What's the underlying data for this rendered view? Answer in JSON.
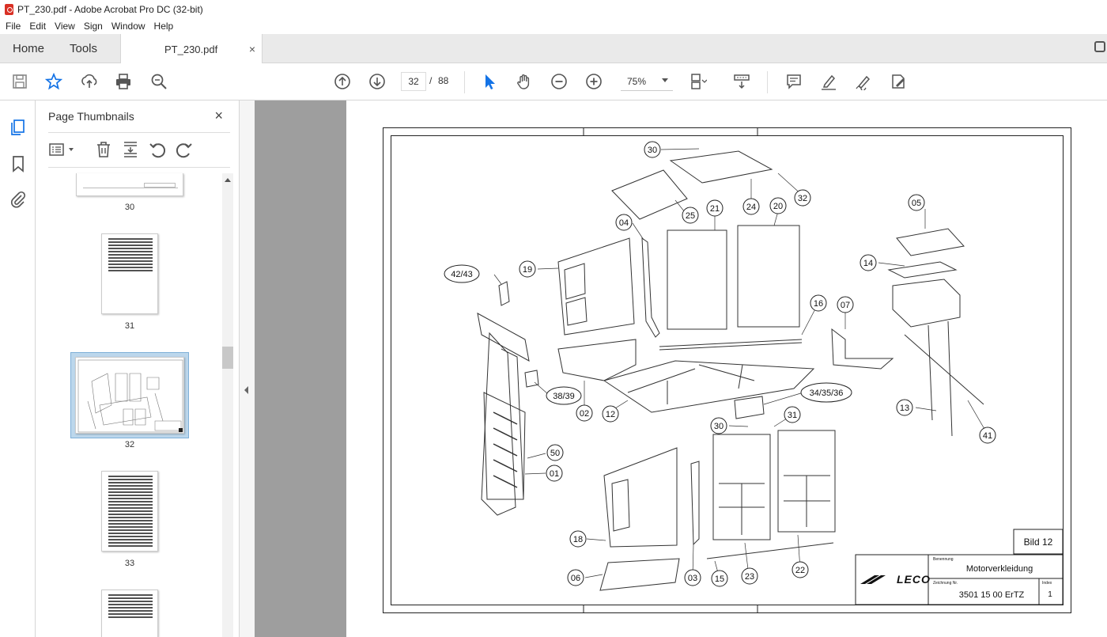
{
  "window": {
    "title": "PT_230.pdf - Adobe Acrobat Pro DC (32-bit)"
  },
  "menu": [
    "File",
    "Edit",
    "View",
    "Sign",
    "Window",
    "Help"
  ],
  "tabs": {
    "home": "Home",
    "tools": "Tools",
    "document": "PT_230.pdf",
    "close": "×"
  },
  "toolbar": {
    "page_current": "32",
    "page_separator": "/",
    "page_total": "88",
    "zoom": "75%",
    "icons": [
      "save-icon",
      "star-icon",
      "upload-icon",
      "print-icon",
      "zoom-search-icon",
      "page-up-icon",
      "page-down-icon",
      "select-cursor-icon",
      "hand-icon",
      "zoom-out-icon",
      "zoom-in-icon",
      "page-display-icon",
      "scroll-mode-icon",
      "comment-icon",
      "highlight-icon",
      "sign-icon",
      "redact-icon"
    ]
  },
  "thumbnails": {
    "title": "Page Thumbnails",
    "close": "×",
    "pages": [
      {
        "label": "30"
      },
      {
        "label": "31"
      },
      {
        "label": "32",
        "selected": true
      },
      {
        "label": "33"
      }
    ]
  },
  "drawing": {
    "callouts": [
      "30",
      "24",
      "32",
      "25",
      "21",
      "20",
      "04",
      "05",
      "14",
      "19",
      "42/43",
      "16",
      "07",
      "38/39",
      "02",
      "12",
      "34/35/36",
      "13",
      "41",
      "30",
      "31",
      "50",
      "01",
      "18",
      "23",
      "22",
      "06",
      "03",
      "15"
    ],
    "bild_label": "Bild 12",
    "benennung_label": "Benennung",
    "title": "Motorverkleidung",
    "zeichnung_label": "Zeichnung Nr.",
    "drawing_number": "3501 15 00 ErTZ",
    "index_label": "Index",
    "sheet": "1",
    "logo": "LECO"
  },
  "colors": {
    "accent": "#1473e6",
    "tabbar": "#eaeaea",
    "page_gray": "#9e9e9e",
    "selection": "#bcd7ec"
  }
}
